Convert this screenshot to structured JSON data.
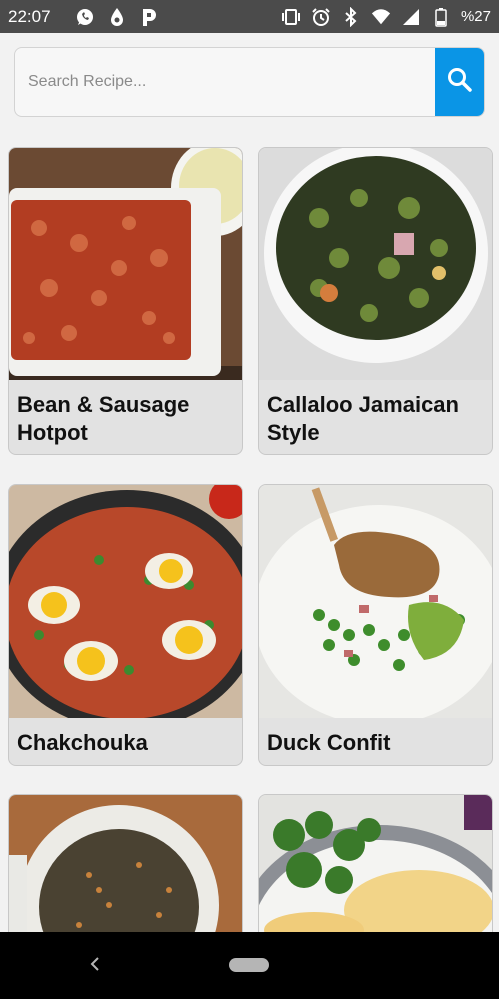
{
  "status_bar": {
    "time": "22:07",
    "battery": "%27",
    "left_icons": [
      "whatsapp-icon",
      "drop-icon",
      "p-app-icon"
    ],
    "right_icons": [
      "vibrate-icon",
      "alarm-icon",
      "bluetooth-icon",
      "wifi-icon",
      "signal-icon",
      "battery-icon"
    ]
  },
  "search": {
    "placeholder": "Search Recipe...",
    "value": "",
    "button_icon": "search-icon",
    "accent": "#0a95e6"
  },
  "recipes": [
    {
      "title": "Bean & Sausage Hotpot",
      "image": "beans-dish-photo"
    },
    {
      "title": "Callaloo Jamaican Style",
      "image": "greens-bowl-photo"
    },
    {
      "title": "Chakchouka",
      "image": "shakshuka-pan-photo"
    },
    {
      "title": "Duck Confit",
      "image": "duck-plate-photo"
    },
    {
      "title": "",
      "image": "lentils-bowl-photo"
    },
    {
      "title": "",
      "image": "omelette-salad-photo"
    }
  ],
  "nav_bar": {
    "back_icon": "back-icon",
    "home_icon": "home-pill-icon"
  }
}
